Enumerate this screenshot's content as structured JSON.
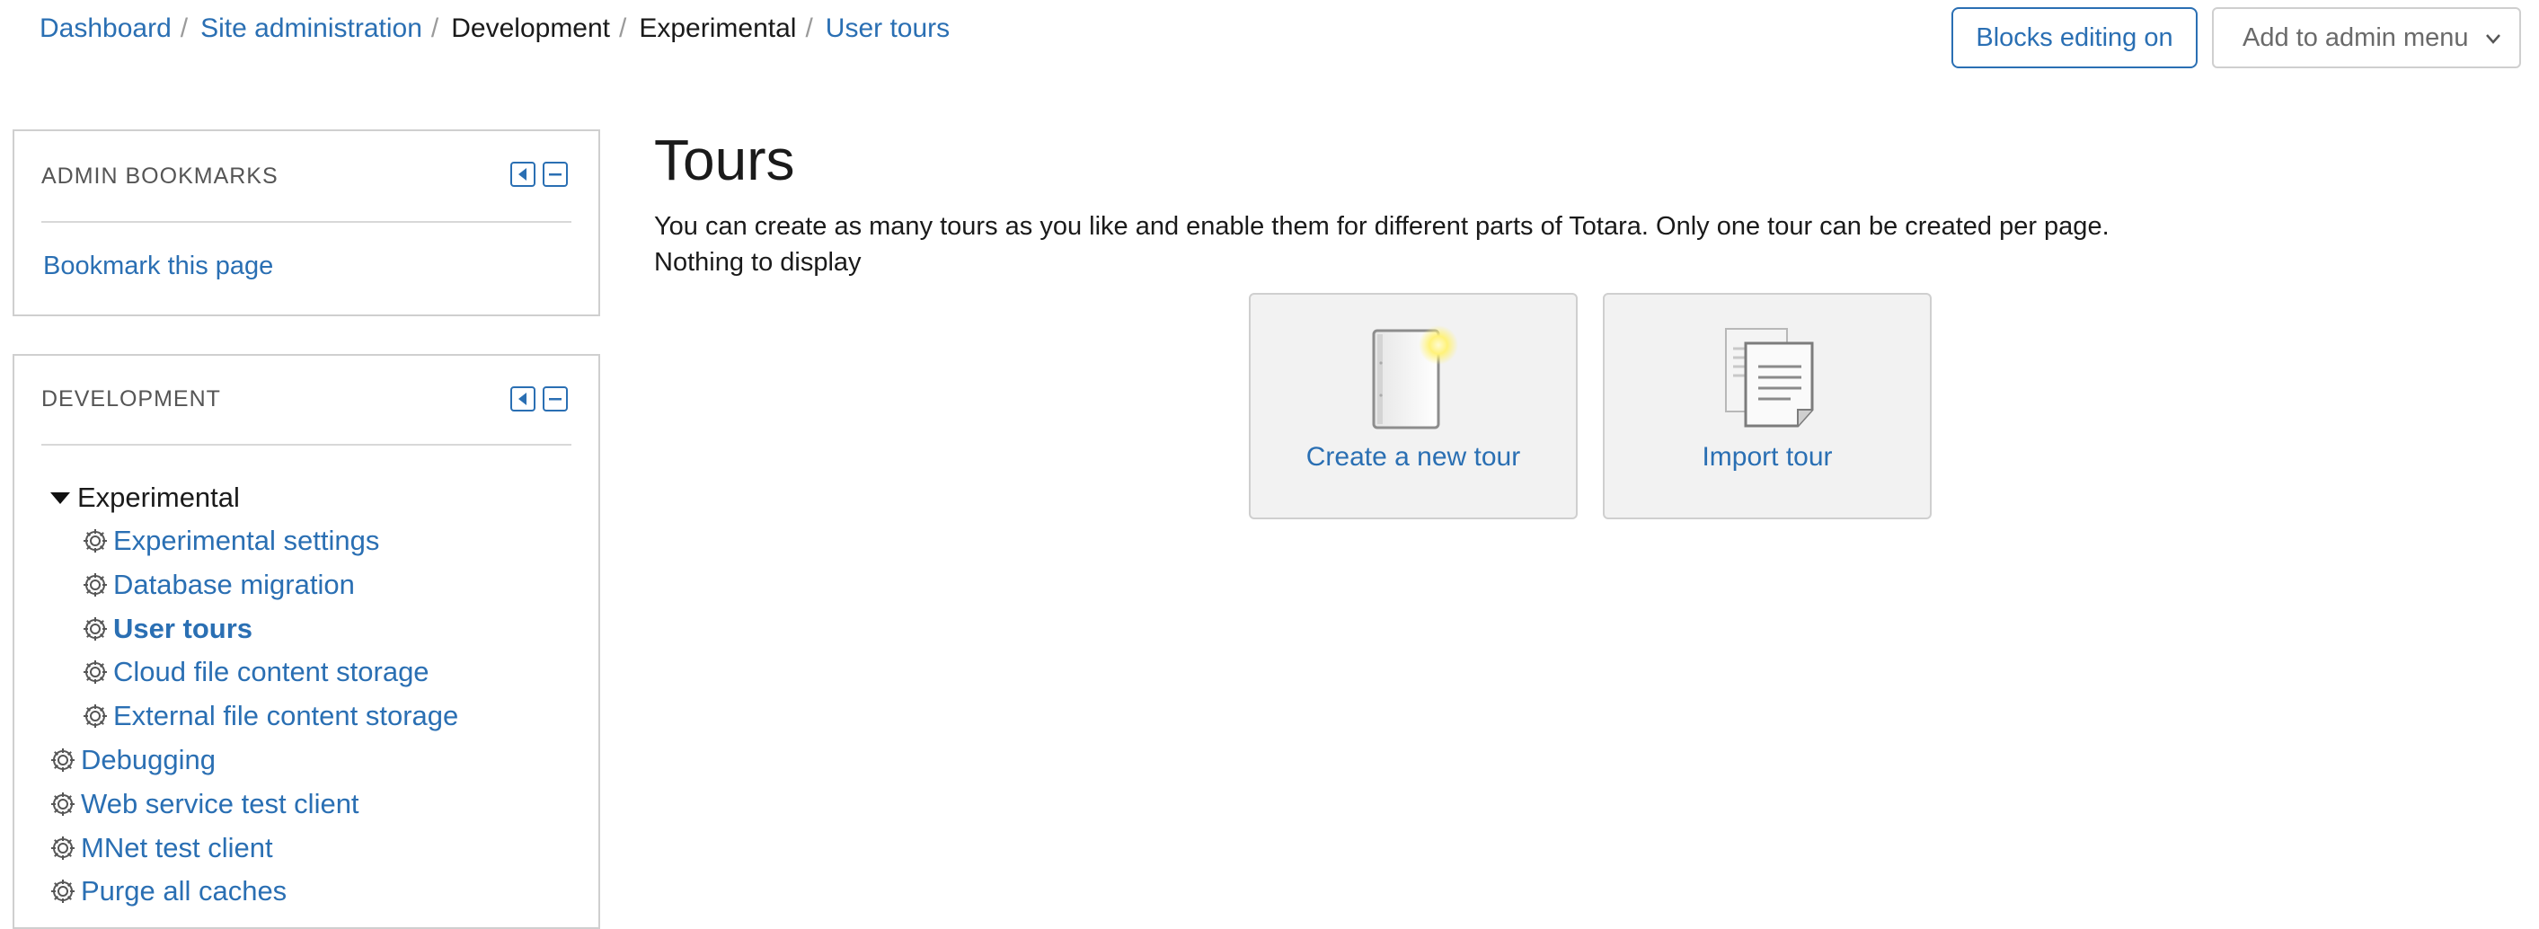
{
  "breadcrumb": {
    "items": [
      {
        "label": "Dashboard",
        "link": true
      },
      {
        "label": "Site administration",
        "link": true
      },
      {
        "label": "Development",
        "link": false
      },
      {
        "label": "Experimental",
        "link": false
      },
      {
        "label": "User tours",
        "link": true
      }
    ],
    "separator": "/"
  },
  "header_buttons": {
    "blocks_editing": "Blocks editing on",
    "admin_menu_selected": "Add to admin menu"
  },
  "blocks": {
    "bookmarks": {
      "title": "ADMIN BOOKMARKS",
      "link": "Bookmark this page"
    },
    "development": {
      "title": "DEVELOPMENT",
      "items": [
        {
          "label": "Experimental",
          "icon": "triangle-down-icon",
          "type": "category"
        },
        {
          "label": "Experimental settings",
          "icon": "gear-icon"
        },
        {
          "label": "Database migration",
          "icon": "gear-icon"
        },
        {
          "label": "User tours",
          "icon": "gear-icon",
          "active": true
        },
        {
          "label": "Cloud file content storage",
          "icon": "gear-icon"
        },
        {
          "label": "External file content storage",
          "icon": "gear-icon"
        },
        {
          "label": "Debugging",
          "icon": "gear-icon"
        },
        {
          "label": "Web service test client",
          "icon": "gear-icon"
        },
        {
          "label": "MNet test client",
          "icon": "gear-icon"
        },
        {
          "label": "Purge all caches",
          "icon": "gear-icon"
        }
      ]
    }
  },
  "main": {
    "title": "Tours",
    "description": "You can create as many tours as you like and enable them for different parts of Totara. Only one tour can be created per page.",
    "empty_message": "Nothing to display",
    "actions": [
      {
        "label": "Create a new tour",
        "icon": "new-document-icon"
      },
      {
        "label": "Import tour",
        "icon": "import-document-icon"
      }
    ]
  },
  "colors": {
    "link": "#2a6fb3",
    "tile_bg": "#f2f2f2",
    "border": "#cfcfcf"
  }
}
